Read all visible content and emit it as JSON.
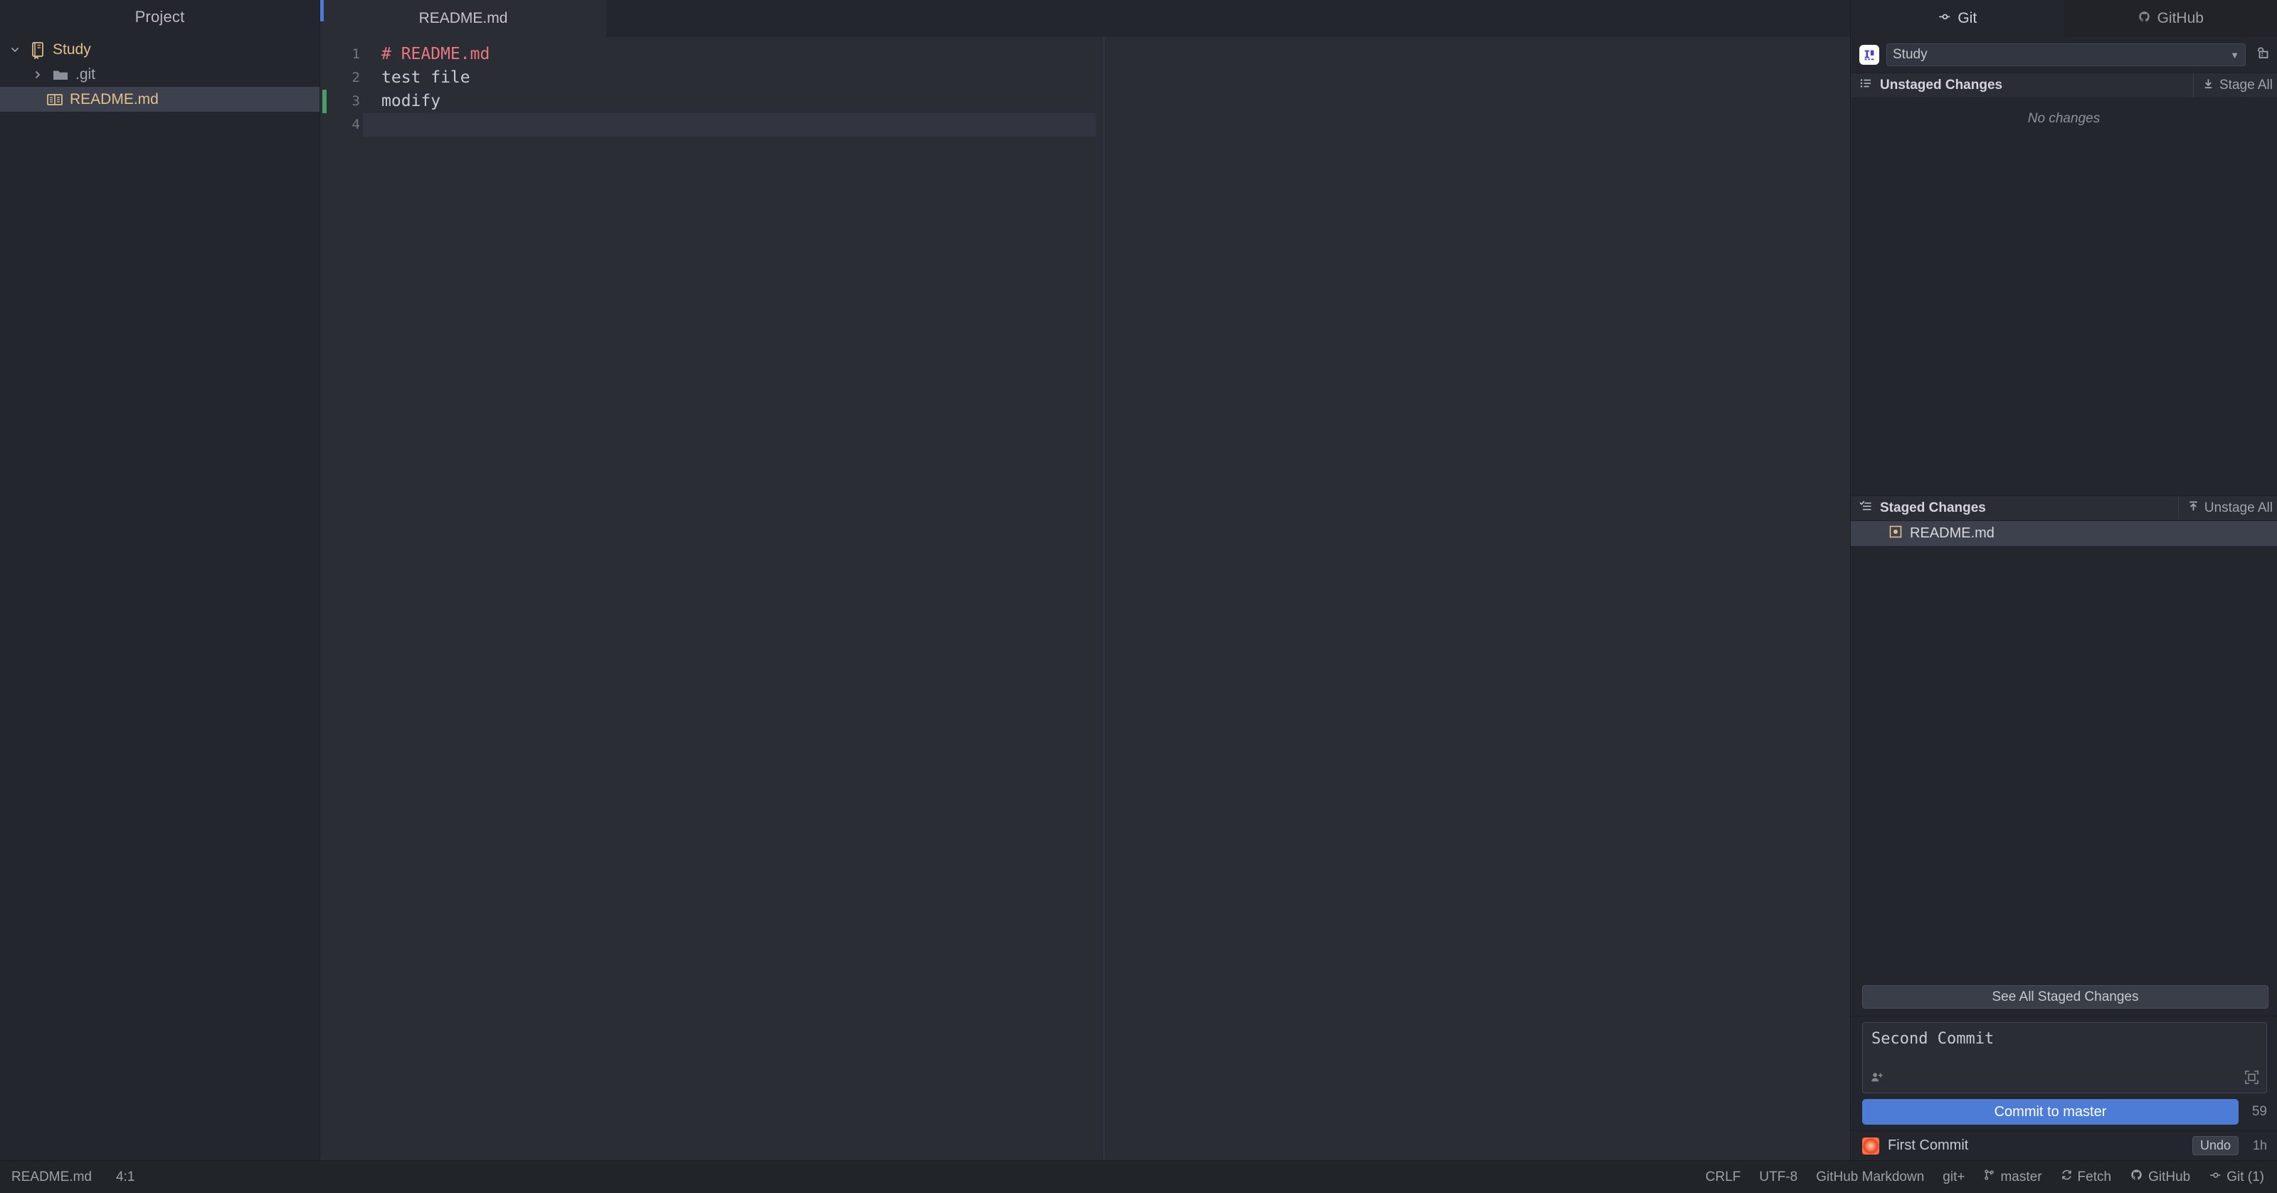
{
  "project": {
    "header": "Project",
    "tree": [
      {
        "label": "Study",
        "kind": "project",
        "icon": "module-icon",
        "chevron": "expanded",
        "depth": 0,
        "selected": false
      },
      {
        "label": ".git",
        "kind": "folder",
        "icon": "folder-icon",
        "chevron": "collapsed",
        "depth": 1,
        "selected": false
      },
      {
        "label": "README.md",
        "kind": "file",
        "icon": "markdown-icon",
        "chevron": "none",
        "depth": 1,
        "selected": true
      }
    ]
  },
  "editor": {
    "tab": {
      "label": "README.md"
    },
    "lines": [
      {
        "no": "1",
        "text": "# README.md",
        "token": "heading"
      },
      {
        "no": "2",
        "text": "test file",
        "token": "plain"
      },
      {
        "no": "3",
        "text": "modify",
        "token": "plain"
      },
      {
        "no": "4",
        "text": "",
        "token": "plain"
      }
    ],
    "current_line": 4,
    "changed_line": 3
  },
  "git": {
    "tabs": [
      {
        "label": "Git",
        "icon": "git-branch-icon",
        "active": true
      },
      {
        "label": "GitHub",
        "icon": "github-icon",
        "active": false
      }
    ],
    "repository": {
      "value": "Study",
      "logo": "jetbrains-logo-icon",
      "new_window_icon": "open-in-new-window-icon"
    },
    "unstaged": {
      "title": "Unstaged Changes",
      "icon": "list-icon",
      "action": {
        "label": "Stage All",
        "icon": "stage-down-icon"
      },
      "empty_text": "No changes",
      "files": []
    },
    "staged": {
      "title": "Staged Changes",
      "icon": "checked-list-icon",
      "action": {
        "label": "Unstage All",
        "icon": "unstage-up-icon"
      },
      "files": [
        {
          "label": "README.md",
          "icon": "modified-file-icon",
          "selected": true
        }
      ]
    },
    "see_all_staged": "See All Staged Changes",
    "commit": {
      "message": "Second Commit",
      "author_icon": "add-coauthor-icon",
      "expand_icon": "expand-editor-icon",
      "button_label": "Commit to master",
      "char_count": "59"
    },
    "recent_commit": {
      "title": "First Commit",
      "avatar": "user-avatar-icon",
      "undo_label": "Undo",
      "time": "1h"
    }
  },
  "statusbar": {
    "left": [
      {
        "label": "README.md",
        "name": "status-file-name"
      },
      {
        "label": "4:1",
        "name": "status-caret-position"
      }
    ],
    "right": [
      {
        "label": "CRLF",
        "icon": "none",
        "name": "status-line-separator"
      },
      {
        "label": "UTF-8",
        "icon": "none",
        "name": "status-encoding"
      },
      {
        "label": "GitHub Markdown",
        "icon": "none",
        "name": "status-markdown-flavour"
      },
      {
        "label": "git+",
        "icon": "none",
        "name": "status-git-plus"
      },
      {
        "label": "master",
        "icon": "branch-icon",
        "name": "status-branch"
      },
      {
        "label": "Fetch",
        "icon": "refresh-icon",
        "name": "status-fetch"
      },
      {
        "label": "GitHub",
        "icon": "github-icon",
        "name": "status-github"
      },
      {
        "label": "Git (1)",
        "icon": "git-branch-icon",
        "name": "status-git-widget"
      }
    ]
  },
  "colors": {
    "accent_blue": "#4d7cd6",
    "changed_green": "#4a9a6a",
    "heading_red": "#e8777f",
    "file_gold": "#e3c08a",
    "panel_bg": "#24262d",
    "editor_bg": "#2b2d35",
    "selection_bg": "#3d414d"
  }
}
